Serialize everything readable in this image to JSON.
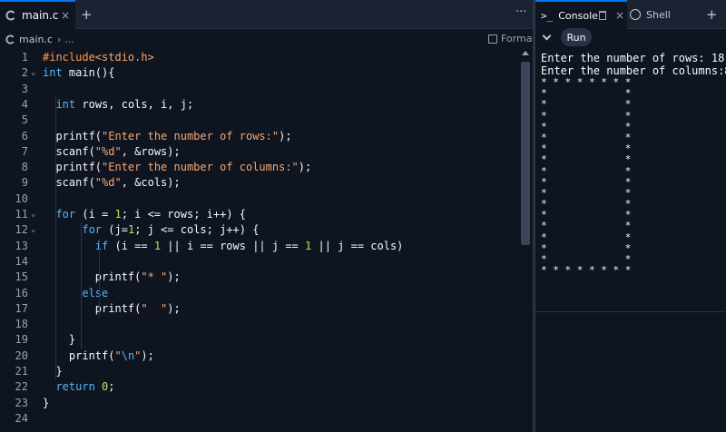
{
  "editor_tab": {
    "filename": "main.c",
    "close": "×",
    "plus": "+",
    "more": "···"
  },
  "breadcrumb": {
    "file": "main.c",
    "sep": "›",
    "more": "..."
  },
  "format_label": "Format",
  "code_lines": [
    {
      "n": "1",
      "fold": "",
      "tokens": [
        {
          "t": "#include",
          "c": "pp"
        },
        {
          "t": "<stdio.h>",
          "c": "str"
        }
      ]
    },
    {
      "n": "2",
      "fold": "⌄",
      "tokens": [
        {
          "t": "int",
          "c": "kw"
        },
        {
          "t": " main(){",
          "c": ""
        }
      ]
    },
    {
      "n": "3",
      "fold": "",
      "tokens": []
    },
    {
      "n": "4",
      "fold": "",
      "tokens": [
        {
          "t": "  ",
          "c": ""
        },
        {
          "t": "int",
          "c": "kw"
        },
        {
          "t": " rows, cols, i, j;",
          "c": ""
        }
      ]
    },
    {
      "n": "5",
      "fold": "",
      "tokens": []
    },
    {
      "n": "6",
      "fold": "",
      "tokens": [
        {
          "t": "  printf(",
          "c": ""
        },
        {
          "t": "\"Enter the number of rows:\"",
          "c": "str"
        },
        {
          "t": ");",
          "c": ""
        }
      ]
    },
    {
      "n": "7",
      "fold": "",
      "tokens": [
        {
          "t": "  scanf(",
          "c": ""
        },
        {
          "t": "\"%d\"",
          "c": "str"
        },
        {
          "t": ", &rows);",
          "c": ""
        }
      ]
    },
    {
      "n": "8",
      "fold": "",
      "tokens": [
        {
          "t": "  printf(",
          "c": ""
        },
        {
          "t": "\"Enter the number of columns:\"",
          "c": "str"
        },
        {
          "t": ");",
          "c": ""
        }
      ]
    },
    {
      "n": "9",
      "fold": "",
      "tokens": [
        {
          "t": "  scanf(",
          "c": ""
        },
        {
          "t": "\"%d\"",
          "c": "str"
        },
        {
          "t": ", &cols);",
          "c": ""
        }
      ]
    },
    {
      "n": "10",
      "fold": "",
      "tokens": []
    },
    {
      "n": "11",
      "fold": "⌄",
      "tokens": [
        {
          "t": "  ",
          "c": ""
        },
        {
          "t": "for",
          "c": "kw"
        },
        {
          "t": " (i = ",
          "c": ""
        },
        {
          "t": "1",
          "c": "num"
        },
        {
          "t": "; i <= rows; i++) {",
          "c": ""
        }
      ]
    },
    {
      "n": "12",
      "fold": "⌄",
      "tokens": [
        {
          "t": "      ",
          "c": ""
        },
        {
          "t": "for",
          "c": "kw"
        },
        {
          "t": " (j=",
          "c": ""
        },
        {
          "t": "1",
          "c": "num"
        },
        {
          "t": "; j <= cols; j++) {",
          "c": ""
        }
      ]
    },
    {
      "n": "13",
      "fold": "",
      "tokens": [
        {
          "t": "        ",
          "c": ""
        },
        {
          "t": "if",
          "c": "kw"
        },
        {
          "t": " (i == ",
          "c": ""
        },
        {
          "t": "1",
          "c": "num"
        },
        {
          "t": " || i == rows || j == ",
          "c": ""
        },
        {
          "t": "1",
          "c": "num"
        },
        {
          "t": " || j == cols)",
          "c": ""
        }
      ]
    },
    {
      "n": "14",
      "fold": "",
      "tokens": []
    },
    {
      "n": "15",
      "fold": "",
      "tokens": [
        {
          "t": "        printf(",
          "c": ""
        },
        {
          "t": "\"* \"",
          "c": "str"
        },
        {
          "t": ");",
          "c": ""
        }
      ]
    },
    {
      "n": "16",
      "fold": "",
      "tokens": [
        {
          "t": "      ",
          "c": ""
        },
        {
          "t": "else",
          "c": "kw"
        }
      ]
    },
    {
      "n": "17",
      "fold": "",
      "tokens": [
        {
          "t": "        printf(",
          "c": ""
        },
        {
          "t": "\"  \"",
          "c": "str"
        },
        {
          "t": ");",
          "c": ""
        }
      ]
    },
    {
      "n": "18",
      "fold": "",
      "tokens": []
    },
    {
      "n": "19",
      "fold": "",
      "tokens": [
        {
          "t": "    }",
          "c": ""
        }
      ]
    },
    {
      "n": "20",
      "fold": "",
      "tokens": [
        {
          "t": "    printf(",
          "c": ""
        },
        {
          "t": "\"",
          "c": "str"
        },
        {
          "t": "\\n",
          "c": "esc"
        },
        {
          "t": "\"",
          "c": "str"
        },
        {
          "t": ");",
          "c": ""
        }
      ]
    },
    {
      "n": "21",
      "fold": "",
      "tokens": [
        {
          "t": "  }",
          "c": ""
        }
      ]
    },
    {
      "n": "22",
      "fold": "",
      "tokens": [
        {
          "t": "  ",
          "c": ""
        },
        {
          "t": "return",
          "c": "kw"
        },
        {
          "t": " ",
          "c": ""
        },
        {
          "t": "0",
          "c": "num"
        },
        {
          "t": ";",
          "c": ""
        }
      ]
    },
    {
      "n": "23",
      "fold": "",
      "tokens": [
        {
          "t": "}",
          "c": ""
        }
      ]
    },
    {
      "n": "24",
      "fold": "",
      "tokens": []
    }
  ],
  "console_tabs": {
    "prompt": ">_",
    "console": "Console",
    "close": "×",
    "shell": "Shell",
    "plus": "+"
  },
  "run_label": "Run",
  "console_output": {
    "prompt_rows": "Enter the number of rows: 18",
    "prompt_cols": "Enter the number of columns:8",
    "star_lines": [
      "* * * * * * * *",
      "*             *",
      "*             *",
      "*             *",
      "*             *",
      "*             *",
      "*             *",
      "*             *",
      "*             *",
      "*             *",
      "*             *",
      "*             *",
      "*             *",
      "*             *",
      "*             *",
      "*             *",
      "*             *",
      "* * * * * * * *"
    ]
  },
  "colors": {
    "accent": "#0079f2",
    "background": "#0f1520",
    "tabbar": "#1b2333",
    "keyword": "#56b6f7",
    "string": "#f8a66f",
    "number": "#b2e55c"
  }
}
